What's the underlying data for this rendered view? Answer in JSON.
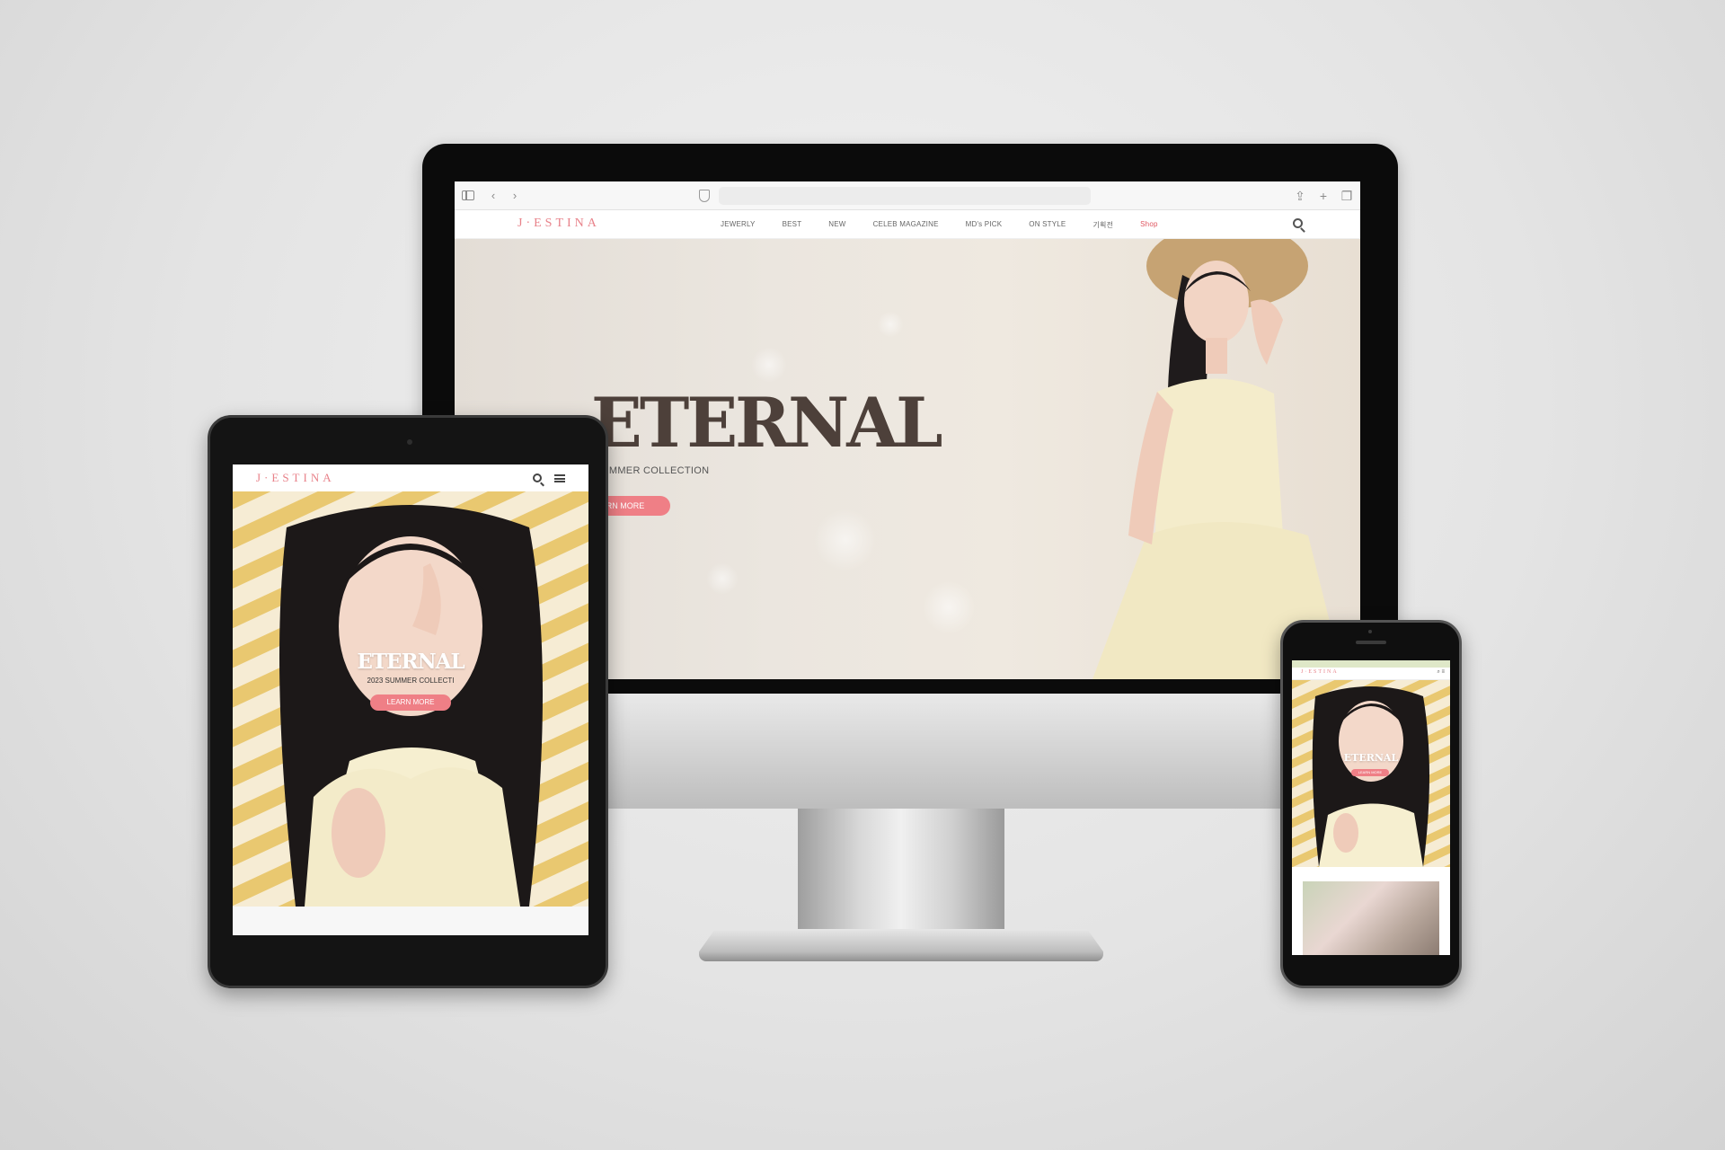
{
  "desktop": {
    "brand": "J·ESTINA",
    "nav": {
      "items": [
        "JEWERLY",
        "BEST",
        "NEW",
        "CELEB MAGAZINE",
        "MD's PICK",
        "ON STYLE",
        "기획전",
        "Shop"
      ]
    },
    "hero": {
      "title": "ETERNAL",
      "subtitle": "SUMMER COLLECTION",
      "button": "RN MORE"
    },
    "browser": {
      "icons": [
        "sidebar-icon",
        "back-icon",
        "forward-icon",
        "shield-icon",
        "share-icon",
        "new-tab-icon",
        "tabs-icon"
      ]
    }
  },
  "tablet": {
    "brand": "J·ESTINA",
    "hero": {
      "title": "ETERNAL",
      "subtitle": "2023 SUMMER COLLECTI",
      "button": "LEARN MORE"
    }
  },
  "phone": {
    "brand": "J·ESTINA",
    "hero": {
      "title": "ETERNAL",
      "button": "LEARN MORE"
    }
  },
  "colors": {
    "accent": "#ef7f86",
    "brand": "#e8828a",
    "title": "#4d403a"
  }
}
